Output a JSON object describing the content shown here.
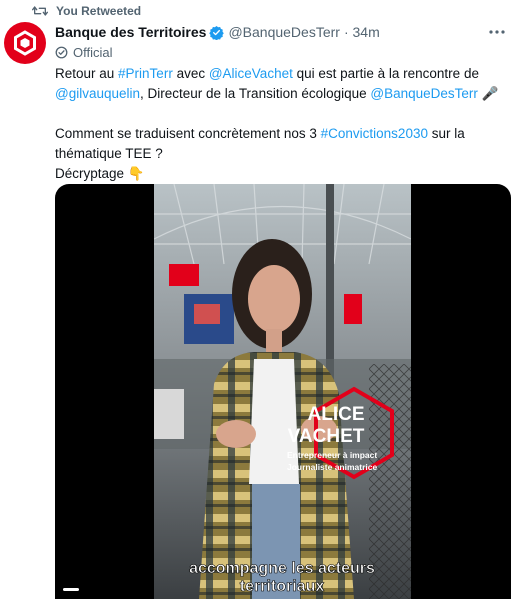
{
  "retweet": {
    "label": "You Retweeted",
    "icon": "retweet-icon"
  },
  "author": {
    "display_name": "Banque des Territoires",
    "handle": "@BanqueDesTerr",
    "time": "· 34m",
    "badge": "Official",
    "verified_icon": "verified-badge-icon",
    "brand_color": "#e2001a"
  },
  "tweet": {
    "segments": [
      {
        "text": "Retour au ",
        "link": false
      },
      {
        "text": "#PrinTerr",
        "link": true
      },
      {
        "text": " avec ",
        "link": false
      },
      {
        "text": "@AliceVachet",
        "link": true
      },
      {
        "text": " qui est partie à la rencontre de ",
        "link": false
      },
      {
        "text": "@gilvauquelin",
        "link": true
      },
      {
        "text": ", Directeur de la Transition écologique ",
        "link": false
      },
      {
        "text": "@BanqueDesTerr",
        "link": true
      },
      {
        "text": " 🎤",
        "link": false
      },
      {
        "text": "\n\n",
        "link": false
      },
      {
        "text": "Comment se traduisent concrètement nos 3 ",
        "link": false
      },
      {
        "text": "#Convictions2030",
        "link": true
      },
      {
        "text": " sur la thématique TEE ?",
        "link": false
      },
      {
        "text": "\n",
        "link": false
      },
      {
        "text": "Décryptage 👇",
        "link": false
      }
    ],
    "link_color": "#1d9bf0"
  },
  "video": {
    "name_line1": "ALICE",
    "name_line2": "VACHET",
    "role_line1": "Entrepreneur à impact",
    "role_line2": "Journaliste animatrice",
    "subtitle_line1": "accompagne les acteurs",
    "subtitle_line2": "territoriaux",
    "accent_color": "#e2001a"
  }
}
